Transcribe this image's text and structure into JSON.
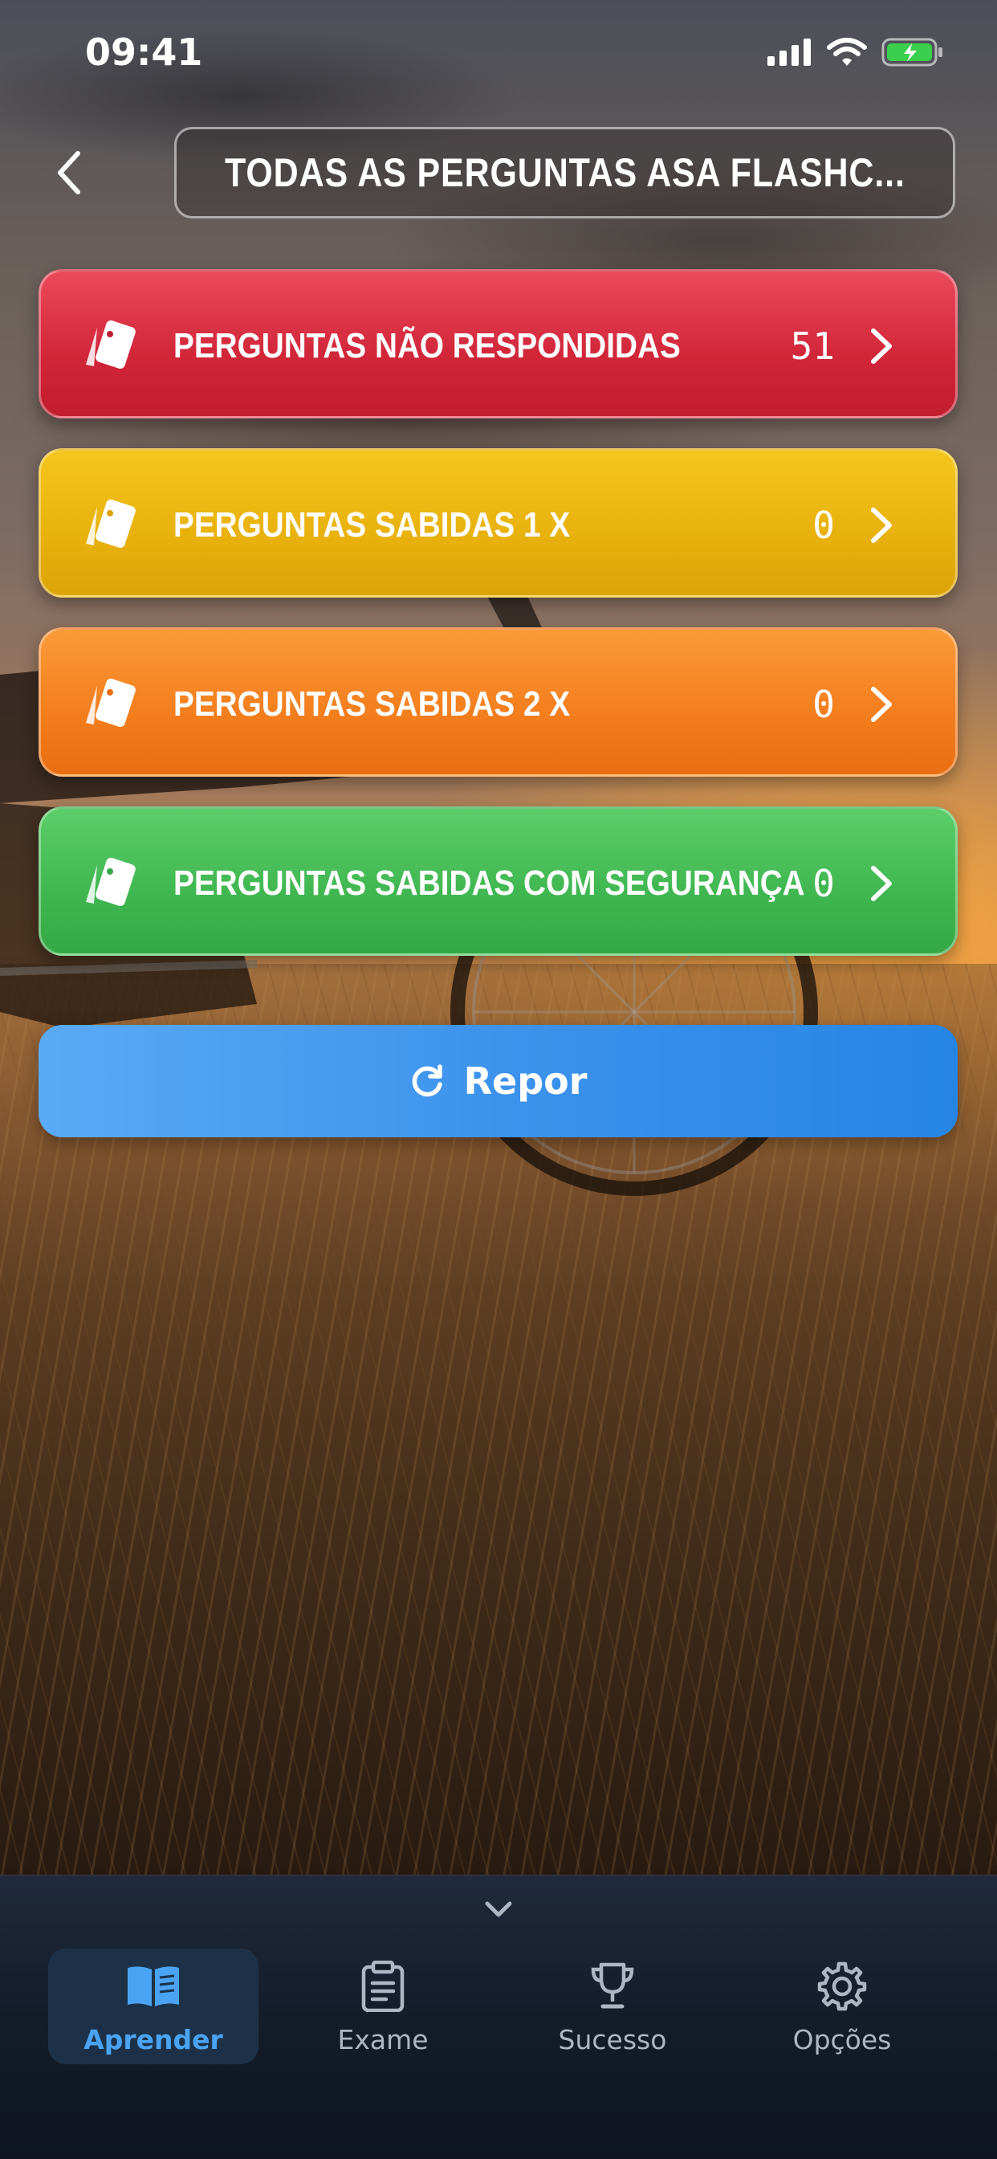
{
  "status_bar": {
    "time": "09:41"
  },
  "header": {
    "title": "TODAS AS PERGUNTAS ASA FLASHC..."
  },
  "categories": [
    {
      "label": "PERGUNTAS NÃO RESPONDIDAS",
      "count": "51",
      "color": "#d12538"
    },
    {
      "label": "PERGUNTAS SABIDAS 1 X",
      "count": "0",
      "color": "#e8b10d"
    },
    {
      "label": "PERGUNTAS SABIDAS 2 X",
      "count": "0",
      "color": "#f37d1c"
    },
    {
      "label": "PERGUNTAS SABIDAS COM SEGURANÇA",
      "count": "0",
      "color": "#3fb650"
    }
  ],
  "reset": {
    "label": "Repor",
    "icon": "refresh-icon",
    "color": "#3d93ec"
  },
  "nav": {
    "items": [
      {
        "label": "Aprender",
        "icon": "book-icon",
        "active": true
      },
      {
        "label": "Exame",
        "icon": "clipboard-icon",
        "active": false
      },
      {
        "label": "Sucesso",
        "icon": "trophy-icon",
        "active": false
      },
      {
        "label": "Opções",
        "icon": "gear-icon",
        "active": false
      }
    ],
    "active_color": "#4aa3f2"
  }
}
